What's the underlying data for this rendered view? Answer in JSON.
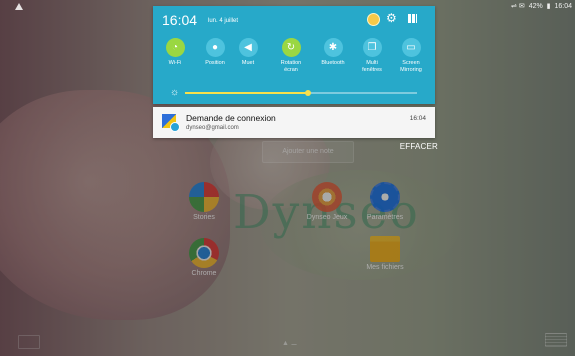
{
  "status_bar": {
    "battery": "42%",
    "time": "16:04"
  },
  "quick_panel": {
    "time": "16:04",
    "date": "lun. 4 juillet",
    "toggles": [
      {
        "label": "Wi-Fi",
        "icon": "wifi-icon",
        "active": true
      },
      {
        "label": "Position",
        "icon": "location-icon",
        "active": false
      },
      {
        "label": "Muet",
        "icon": "mute-icon",
        "active": false
      },
      {
        "label": "Rotation\nécran",
        "icon": "rotation-icon",
        "active": true
      },
      {
        "label": "Bluetooth",
        "icon": "bluetooth-icon",
        "active": false
      },
      {
        "label": "Multi\nfenêtres",
        "icon": "multiwindow-icon",
        "active": false
      },
      {
        "label": "Screen\nMirroring",
        "icon": "screen-mirroring-icon",
        "active": false
      }
    ],
    "brightness_level": 0.53
  },
  "notification": {
    "title": "Demande de connexion",
    "subtitle": "dynseo@gmail.com",
    "time": "16:04"
  },
  "background": {
    "widget_label": "Ajouter une note",
    "clear_label": "EFFACER",
    "logo_text": "Dynseo",
    "apps": [
      {
        "label": "Stories",
        "icon": "stories-icon"
      },
      {
        "label": "Chrome",
        "icon": "chrome-icon"
      },
      {
        "label": "Dynseo Jeux",
        "icon": "dynseo-app-icon"
      },
      {
        "label": "Paramètres",
        "icon": "settings-icon"
      },
      {
        "label": "Mes fichiers",
        "icon": "folder-icon"
      }
    ]
  },
  "colors": {
    "panel": "#27a9c9",
    "tile_active": "#9ad742",
    "tile_inactive": "#4ec3de",
    "slider": "#f7e04b"
  }
}
